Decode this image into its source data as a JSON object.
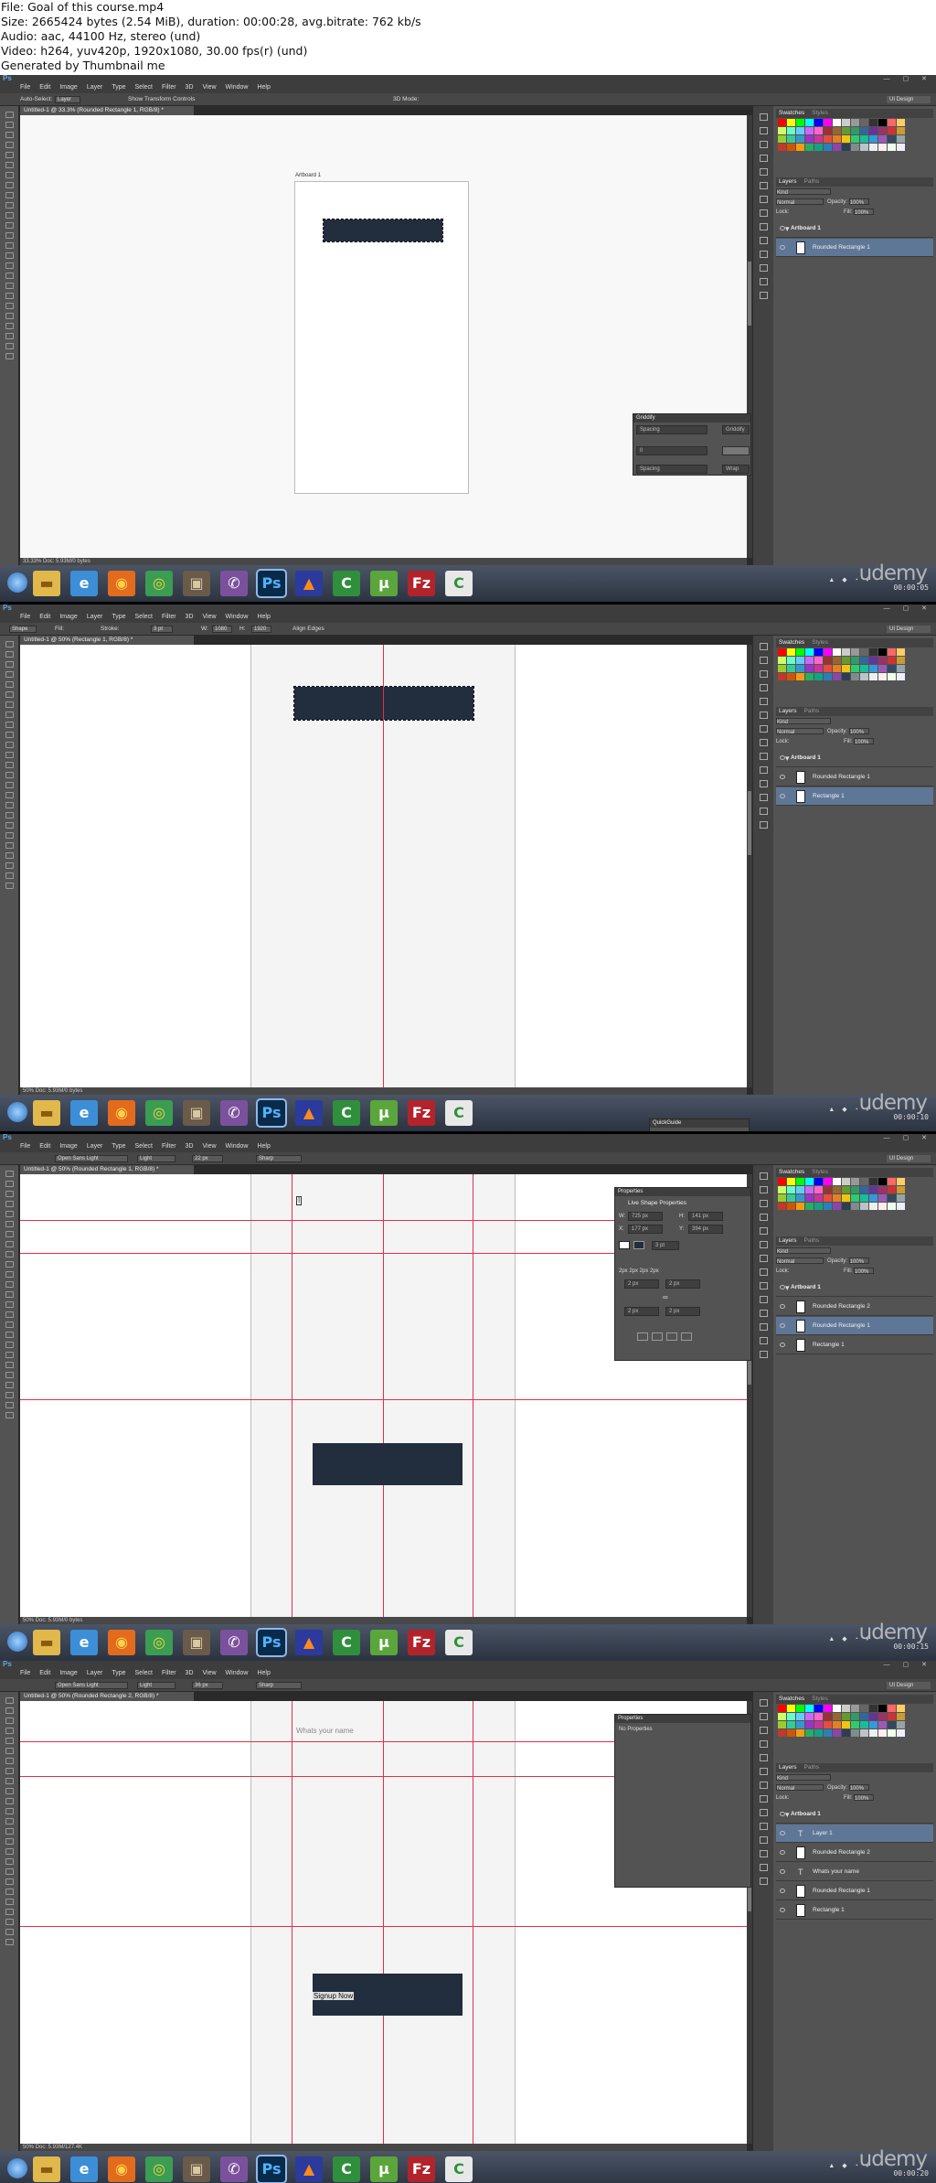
{
  "info": {
    "line1": "File: Goal of this course.mp4",
    "line2": "Size: 2665424 bytes (2.54 MiB), duration: 00:00:28, avg.bitrate: 762 kb/s",
    "line3": "Audio: aac, 44100 Hz, stereo (und)",
    "line4": "Video: h264, yuv420p, 1920x1080, 30.00 fps(r) (und)",
    "line5": "Generated by Thumbnail me"
  },
  "common": {
    "menu": [
      "File",
      "Edit",
      "Image",
      "Layer",
      "Type",
      "Select",
      "Filter",
      "3D",
      "View",
      "Window",
      "Help"
    ],
    "workspace": "UI Design",
    "panel_tabs": [
      "Swatches",
      "Styles"
    ],
    "layer_tabs": [
      "Layers",
      "Paths"
    ],
    "kind": "Kind",
    "blend": "Normal",
    "opacity_label": "Opacity:",
    "opacity": "100%",
    "lock_label": "Lock:",
    "fill_label": "Fill:",
    "fill": "100%",
    "brand": "udemy",
    "swatch_colors": [
      "#ff0000",
      "#ffff00",
      "#00ff00",
      "#00ffff",
      "#0000ff",
      "#ff00ff",
      "#ffffff",
      "#cccccc",
      "#999999",
      "#666666",
      "#333333",
      "#000000",
      "#ff6666",
      "#ffcc66",
      "#ccff66",
      "#66ffcc",
      "#66ccff",
      "#cc66ff",
      "#ff66cc",
      "#993333",
      "#996633",
      "#669933",
      "#339966",
      "#336699",
      "#663399",
      "#993366",
      "#cc3333",
      "#cc9933",
      "#99cc33",
      "#33cc99",
      "#3399cc",
      "#9933cc",
      "#cc3399",
      "#e74c3c",
      "#e67e22",
      "#f1c40f",
      "#2ecc71",
      "#1abc9c",
      "#3498db",
      "#9b59b6",
      "#34495e",
      "#95a5a6",
      "#c0392b",
      "#d35400",
      "#f39c12",
      "#27ae60",
      "#16a085",
      "#2980b9",
      "#8e44ad",
      "#2c3e50",
      "#7f8c8d",
      "#bdc3c7",
      "#ecf0f1",
      "#ffeeee",
      "#eeffee",
      "#eeeeff"
    ]
  },
  "frames": [
    {
      "tab": "Untitled-1 @ 33.3% (Rounded Rectangle 1, RGB/8) *",
      "options": [
        "Auto-Select:",
        "Layer",
        "Show Transform Controls",
        "3D Mode:"
      ],
      "artboard_label": "Artboard 1",
      "status": "33.33%   Doc: 5.93M/0 bytes",
      "panel": {
        "title": "Griddify",
        "field1": "Spacing",
        "field2": "0",
        "field3": "Spacing",
        "btn1": "Griddify",
        "btn2": "Wrap"
      },
      "layers": [
        {
          "name": "Artboard 1",
          "type": "group",
          "selected": false
        },
        {
          "name": "Rounded Rectangle 1",
          "type": "shape",
          "selected": true
        }
      ],
      "clock": "00:00:05"
    },
    {
      "tab": "Untitled-1 @ 50% (Rectangle 1, RGB/8) *",
      "options": [
        "Shape",
        "Fill:",
        "Stroke:",
        "3 pt",
        "W:",
        "1080",
        "H:",
        "1920",
        "Align Edges"
      ],
      "status": "50%   Doc: 5.93M/0 bytes",
      "panel": {
        "title": "QuickGuide"
      },
      "layers": [
        {
          "name": "Artboard 1",
          "type": "group",
          "selected": false
        },
        {
          "name": "Rounded Rectangle 1",
          "type": "shape",
          "selected": false
        },
        {
          "name": "Rectangle 1",
          "type": "shape",
          "selected": true
        }
      ],
      "clock": "00:00:10"
    },
    {
      "tab": "Untitled-1 @ 50% (Rounded Rectangle 1, RGB/8) *",
      "options": [
        "Open Sans Light",
        "Light",
        "22 px",
        "Sharp"
      ],
      "status": "50%   Doc: 5.93M/0 bytes",
      "panel": {
        "title": "Properties",
        "subtitle": "Live Shape Properties",
        "w_label": "W:",
        "w": "725 px",
        "h_label": "H:",
        "h": "141 px",
        "x_label": "X:",
        "x": "177 px",
        "y_label": "Y:",
        "y": "394 px",
        "stroke": "3 pt",
        "radii": "2px 2px 2px 2px",
        "r1": "2 px",
        "r2": "2 px",
        "r3": "2 px",
        "r4": "2 px"
      },
      "layers": [
        {
          "name": "Artboard 1",
          "type": "group",
          "selected": false
        },
        {
          "name": "Rounded Rectangle 2",
          "type": "shape",
          "selected": false
        },
        {
          "name": "Rounded Rectangle 1",
          "type": "shape",
          "selected": true
        },
        {
          "name": "Rectangle 1",
          "type": "shape",
          "selected": false
        }
      ],
      "clock": "00:00:15"
    },
    {
      "tab": "Untitled-1 @ 50% (Rounded Rectangle 2, RGB/8) *",
      "options": [
        "Open Sans Light",
        "Light",
        "36 px",
        "Sharp"
      ],
      "status": "50%   Doc: 5.93M/127.4K",
      "canvas_text": "Whats your name",
      "button_text": "Signup Now",
      "panel": {
        "title": "Properties",
        "subtitle": "No Properties"
      },
      "layers": [
        {
          "name": "Artboard 1",
          "type": "group",
          "selected": false
        },
        {
          "name": "Layer 1",
          "type": "text",
          "selected": true
        },
        {
          "name": "Rounded Rectangle 2",
          "type": "shape",
          "selected": false
        },
        {
          "name": "Whats your name",
          "type": "text",
          "selected": false
        },
        {
          "name": "Rounded Rectangle 1",
          "type": "shape",
          "selected": false
        },
        {
          "name": "Rectangle 1",
          "type": "shape",
          "selected": false
        }
      ],
      "clock": "00:00:20"
    }
  ],
  "taskbar_icons": [
    {
      "name": "folder",
      "glyph": "▬",
      "bg": "#e0b84c",
      "fg": "#8a5a10"
    },
    {
      "name": "ie",
      "glyph": "e",
      "bg": "#3c8fd6",
      "fg": "#ffffff"
    },
    {
      "name": "firefox",
      "glyph": "◉",
      "bg": "#e36b1d",
      "fg": "#ffd24a"
    },
    {
      "name": "chrome",
      "glyph": "◎",
      "bg": "#3a9d52",
      "fg": "#f6d33c"
    },
    {
      "name": "media",
      "glyph": "▣",
      "bg": "#6a5a4a",
      "fg": "#d9c8a0"
    },
    {
      "name": "viber",
      "glyph": "✆",
      "bg": "#7b519d",
      "fg": "#ffffff"
    },
    {
      "name": "photoshop",
      "glyph": "Ps",
      "bg": "#0a2a4a",
      "fg": "#4fb3ff"
    },
    {
      "name": "vlc",
      "glyph": "▲",
      "bg": "#2b3a9c",
      "fg": "#ff8a1a"
    },
    {
      "name": "camtasia",
      "glyph": "C",
      "bg": "#2f8f3c",
      "fg": "#ffffff"
    },
    {
      "name": "utorrent",
      "glyph": "µ",
      "bg": "#5aa63c",
      "fg": "#ffffff"
    },
    {
      "name": "filezilla",
      "glyph": "Fz",
      "bg": "#b3232b",
      "fg": "#ffffff"
    },
    {
      "name": "camtasia-recorder",
      "glyph": "C",
      "bg": "#e8e8e8",
      "fg": "#2f8f3c"
    }
  ]
}
